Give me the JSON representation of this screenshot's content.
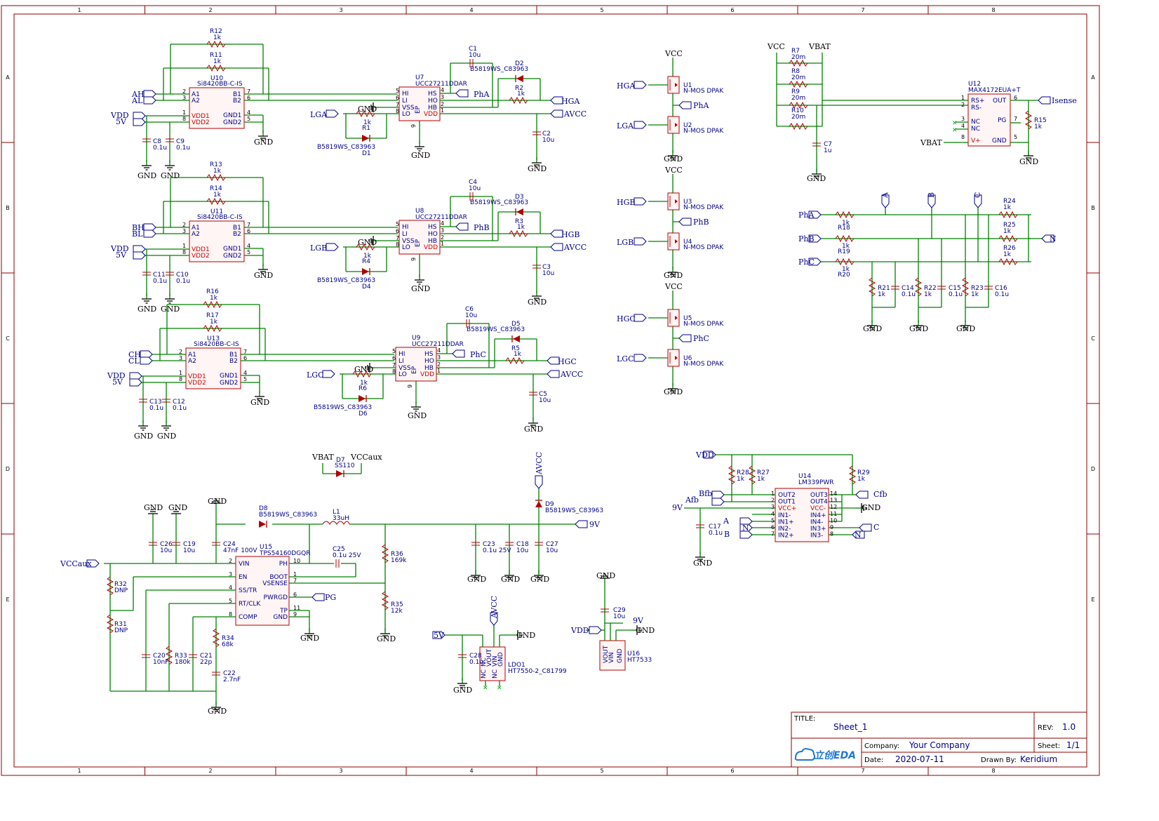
{
  "frame": {
    "cols": [
      "1",
      "2",
      "3",
      "4",
      "5",
      "6",
      "7",
      "8"
    ],
    "rows": [
      "A",
      "B",
      "C",
      "D",
      "E"
    ]
  },
  "titleblock": {
    "title_label": "TITLE:",
    "title": "Sheet_1",
    "rev_label": "REV:",
    "rev": "1.0",
    "company_label": "Company:",
    "company": "Your Company",
    "sheet_label": "Sheet:",
    "sheet": "1/1",
    "date_label": "Date:",
    "date": "2020-07-11",
    "drawn_label": "Drawn By:",
    "drawn": "Keridium",
    "logo": "立创EDA"
  },
  "drivers": [
    {
      "iso": "U10",
      "iso_part": "Si8420BB-C-IS",
      "drv": "U7",
      "drv_part": "UCC27211DDAR",
      "in_h": "AH",
      "in_l": "AL",
      "r_top": "R12",
      "r_top_val": "1k",
      "r_mid": "R11",
      "r_mid_val": "1k",
      "c_a": "C8",
      "c_a_val": "0.1u",
      "c_b": "C9",
      "c_b_val": "0.1u",
      "c_boot": "C1",
      "c_boot_val": "10u",
      "d_hb": "D2",
      "d_hb_part": "B5819WS_C83963",
      "r_g": "R2",
      "r_g_val": "1k",
      "out_h": "HGA",
      "ph": "PhA",
      "lg": "LGA",
      "r_l": "R1",
      "r_l_val": "1k",
      "d_l": "D1",
      "d_l_part": "B5819WS_C83963",
      "c_v": "C2",
      "c_v_val": "10u"
    },
    {
      "iso": "U11",
      "iso_part": "Si8420BB-C-IS",
      "drv": "U8",
      "drv_part": "UCC27211DDAR",
      "in_h": "BH",
      "in_l": "BL",
      "r_top": "R13",
      "r_top_val": "1k",
      "r_mid": "R14",
      "r_mid_val": "1k",
      "c_a": "C11",
      "c_a_val": "0.1u",
      "c_b": "C10",
      "c_b_val": "0.1u",
      "c_boot": "C4",
      "c_boot_val": "10u",
      "d_hb": "D3",
      "d_hb_part": "B5819WS_C83963",
      "r_g": "R3",
      "r_g_val": "1k",
      "out_h": "HGB",
      "ph": "PhB",
      "lg": "LGB",
      "r_l": "R4",
      "r_l_val": "1k",
      "d_l": "D4",
      "d_l_part": "B5819WS_C83963",
      "c_v": "C3",
      "c_v_val": "10u"
    },
    {
      "iso": "U13",
      "iso_part": "Si8420BB-C-IS",
      "drv": "U9",
      "drv_part": "UCC27211DDAR",
      "in_h": "CH",
      "in_l": "CL",
      "r_top": "R16",
      "r_top_val": "1k",
      "r_mid": "R17",
      "r_mid_val": "1k",
      "c_a": "C13",
      "c_a_val": "0.1u",
      "c_b": "C12",
      "c_b_val": "0.1u",
      "c_boot": "C6",
      "c_boot_val": "10u",
      "d_hb": "D5",
      "d_hb_part": "B5819WS_C83963",
      "r_g": "R5",
      "r_g_val": "1k",
      "out_h": "HGC",
      "ph": "PhC",
      "lg": "LGC",
      "r_l": "R6",
      "r_l_val": "1k",
      "d_l": "D6",
      "d_l_part": "B5819WS_C83963",
      "c_v": "C5",
      "c_v_val": "10u"
    }
  ],
  "iso_pins": {
    "a1": "A1",
    "a2": "A2",
    "b1": "B1",
    "b2": "B2",
    "vdd1": "VDD1",
    "vdd2": "VDD2",
    "gnd1": "GND1",
    "gnd2": "GND2",
    "n2": "2",
    "n3": "3",
    "n1": "1",
    "n8": "8",
    "n7": "7",
    "n6": "6",
    "n4": "4",
    "n5": "5"
  },
  "drv_pins": {
    "hi": "HI",
    "li": "LI",
    "vss": "VSS",
    "lo": "LO",
    "hs": "HS",
    "ho": "HO",
    "hb": "HB",
    "vdd": "VDD",
    "ep": "EP",
    "n5": "5",
    "n6": "6",
    "n7": "7",
    "n8": "8",
    "n4": "4",
    "n3": "3",
    "n2": "2",
    "n1": "1",
    "n9": "9"
  },
  "nets": {
    "vdd": "VDD",
    "v5": "5V",
    "gnd": "GND",
    "avcc": "AVCC",
    "vcc": "VCC",
    "vbat": "VBAT",
    "vccaux": "VCCaux",
    "v9": "9V",
    "pg": "PG",
    "isense": "Isense",
    "n": "N",
    "a": "A",
    "b": "B",
    "c": "C",
    "cfb": "Cfb",
    "afb": "Afb",
    "bfb": "Bfb"
  },
  "mosfets": [
    {
      "ref": "U1",
      "part": "N-MOS DPAK",
      "gate": "HGA"
    },
    {
      "ref": "U2",
      "part": "N-MOS DPAK",
      "gate": "LGA",
      "mid": "PhA"
    },
    {
      "ref": "U3",
      "part": "N-MOS DPAK",
      "gate": "HGB"
    },
    {
      "ref": "U4",
      "part": "N-MOS DPAK",
      "gate": "LGB",
      "mid": "PhB"
    },
    {
      "ref": "U5",
      "part": "N-MOS DPAK",
      "gate": "HGC"
    },
    {
      "ref": "U6",
      "part": "N-MOS DPAK",
      "gate": "LGC",
      "mid": "PhC"
    }
  ],
  "sense": {
    "r7": "R7",
    "r8": "R8",
    "r9": "R9",
    "r10": "R10",
    "rval": "20m",
    "c7": "C7",
    "c7_val": "1u",
    "u12": "U12",
    "u12_part": "MAX4172EUA+T",
    "r15": "R15",
    "r15_val": "1k",
    "pins": {
      "rsp": "RS+",
      "rsn": "RS-",
      "nc": "NC",
      "vp": "V+",
      "out": "OUT",
      "pg": "PG",
      "gnd": "GND",
      "n1": "1",
      "n2": "2",
      "n3": "3",
      "n4": "4",
      "n8": "8",
      "n6": "6",
      "n7": "7",
      "n5": "5"
    }
  },
  "divider": {
    "r24": "R24",
    "r25": "R25",
    "r26": "R26",
    "r18": "R18",
    "r19": "R19",
    "r20": "R20",
    "r21": "R21",
    "r22": "R22",
    "r23": "R23",
    "c14": "C14",
    "c15": "C15",
    "c16": "C16",
    "v1k": "1k",
    "v01": "0.1u"
  },
  "comp": {
    "u14": "U14",
    "part": "LM339PWR",
    "r28": "R28",
    "r27": "R27",
    "r29": "R29",
    "v1k": "1k",
    "c17": "C17",
    "c17_val": "0.1u",
    "l": [
      "OUT2",
      "OUT1",
      "VCC+",
      "IN1-",
      "IN1+",
      "IN2-",
      "IN2+"
    ],
    "ln": [
      "1",
      "2",
      "3",
      "4",
      "5",
      "6",
      "7"
    ],
    "r": [
      "OUT3",
      "OUT4",
      "VCC-",
      "IN4+",
      "IN4-",
      "IN3+",
      "IN3-"
    ],
    "rn": [
      "14",
      "13",
      "12",
      "11",
      "10",
      "9",
      "8"
    ]
  },
  "d7": {
    "ref": "D7",
    "part": "SS110"
  },
  "buck": {
    "u15": "U15",
    "part": "TPS54160DGQR",
    "l": [
      "VIN",
      "EN",
      "SS/TR",
      "RT/CLK",
      "COMP"
    ],
    "ln": [
      "2",
      "3",
      "4",
      "5",
      "8"
    ],
    "r": [
      "PH",
      "BOOT",
      "VSENSE",
      "PWRGD",
      "TP",
      "GND"
    ],
    "rn": [
      "10",
      "1",
      "7",
      "6",
      "11",
      "9"
    ],
    "d8": "D8",
    "d8_part": "B5819WS_C83963",
    "l1": "L1",
    "l1_val": "33uH",
    "d9": "D9",
    "d9_part": "B5819WS_C83963",
    "c26": "C26",
    "c26_val": "10u",
    "c19": "C19",
    "c19_val": "10u",
    "c24": "C24",
    "c24_val": "47nF 100V",
    "c25": "C25",
    "c25_val": "0.1u 25V",
    "r36": "R36",
    "r36_val": "169k",
    "r35": "R35",
    "r35_val": "12k",
    "c23": "C23",
    "c23_val": "0.1u 25V",
    "c18": "C18",
    "c18_val": "10u",
    "c27": "C27",
    "c27_val": "10u",
    "r32": "R32",
    "r32_val": "DNP",
    "r31": "R31",
    "r31_val": "DNP",
    "c20": "C20",
    "c20_val": "10nF",
    "r33": "R33",
    "r33_val": "180k",
    "c21": "C21",
    "c21_val": "22p",
    "r34": "R34",
    "r34_val": "68k",
    "c22": "C22",
    "c22_val": "2.7nF"
  },
  "ldo": {
    "ref": "LDO1",
    "part": "HT7550-2_C81799",
    "c28": "C28",
    "c28_val": "0.1u",
    "pins": [
      "NC",
      "VOUT",
      "VIN",
      "NC",
      "NC",
      "GND"
    ]
  },
  "u16": {
    "ref": "U16",
    "part": "HT7533",
    "c29": "C29",
    "c29_val": "10u",
    "pins": [
      "VOUT",
      "VIN",
      "GND"
    ]
  }
}
